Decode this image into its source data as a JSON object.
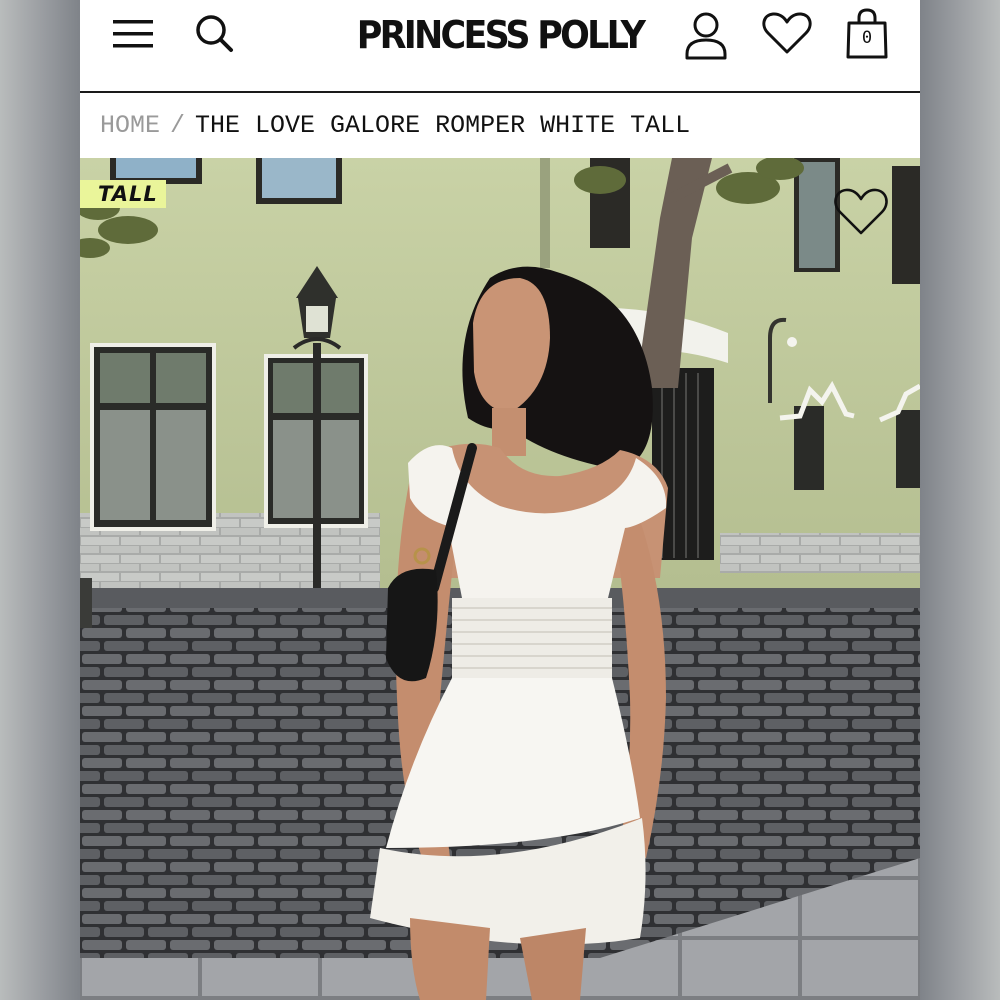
{
  "header": {
    "logo_text": "PRINCESS POLLY",
    "bag_count": "0",
    "icons": [
      "menu-icon",
      "search-icon",
      "account-icon",
      "heart-icon",
      "shopping-bag-icon"
    ]
  },
  "breadcrumb": {
    "home": "HOME",
    "separator": "/",
    "current": "THE LOVE GALORE ROMPER WHITE TALL"
  },
  "product_image": {
    "badge": "TALL",
    "wishlist_icon": "heart-outline-icon"
  },
  "colors": {
    "badge_bg": "#eaf59a",
    "text": "#111111",
    "breadcrumb_muted": "#9a9a9a"
  }
}
